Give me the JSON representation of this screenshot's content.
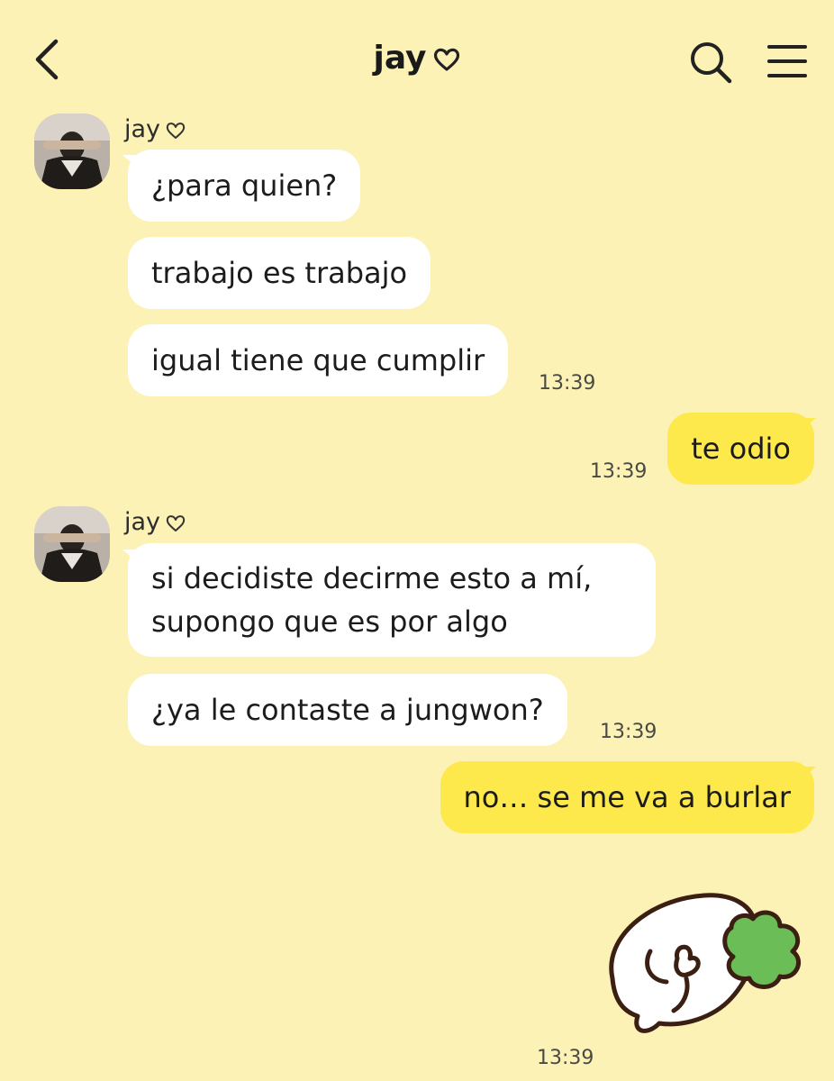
{
  "header": {
    "title": "jay",
    "icons": {
      "back": "chevron-left-icon",
      "title_heart": "heart-outline-icon",
      "search": "search-icon",
      "menu": "hamburger-menu-icon"
    }
  },
  "colors": {
    "background": "#fcf2b6",
    "incoming_bubble": "#ffffff",
    "outgoing_bubble": "#fde94c"
  },
  "messages": [
    {
      "direction": "incoming",
      "sender": "jay",
      "avatar": "profile-photo",
      "lines": [
        "¿para quien?",
        "trabajo es trabajo",
        "igual tiene que cumplir"
      ],
      "time": "13:39"
    },
    {
      "direction": "outgoing",
      "text": "te odio",
      "time": "13:39"
    },
    {
      "direction": "incoming",
      "sender": "jay",
      "avatar": "profile-photo",
      "lines": [
        "si decidiste decirme esto a mí, supongo que es por algo",
        "¿ya le contaste a jungwon?"
      ],
      "time": "13:39"
    },
    {
      "direction": "outgoing",
      "text": "no… se me va a burlar"
    },
    {
      "direction": "outgoing",
      "type": "sticker",
      "sticker": "sleeping-bunny-sticker",
      "time": "13:39"
    }
  ]
}
